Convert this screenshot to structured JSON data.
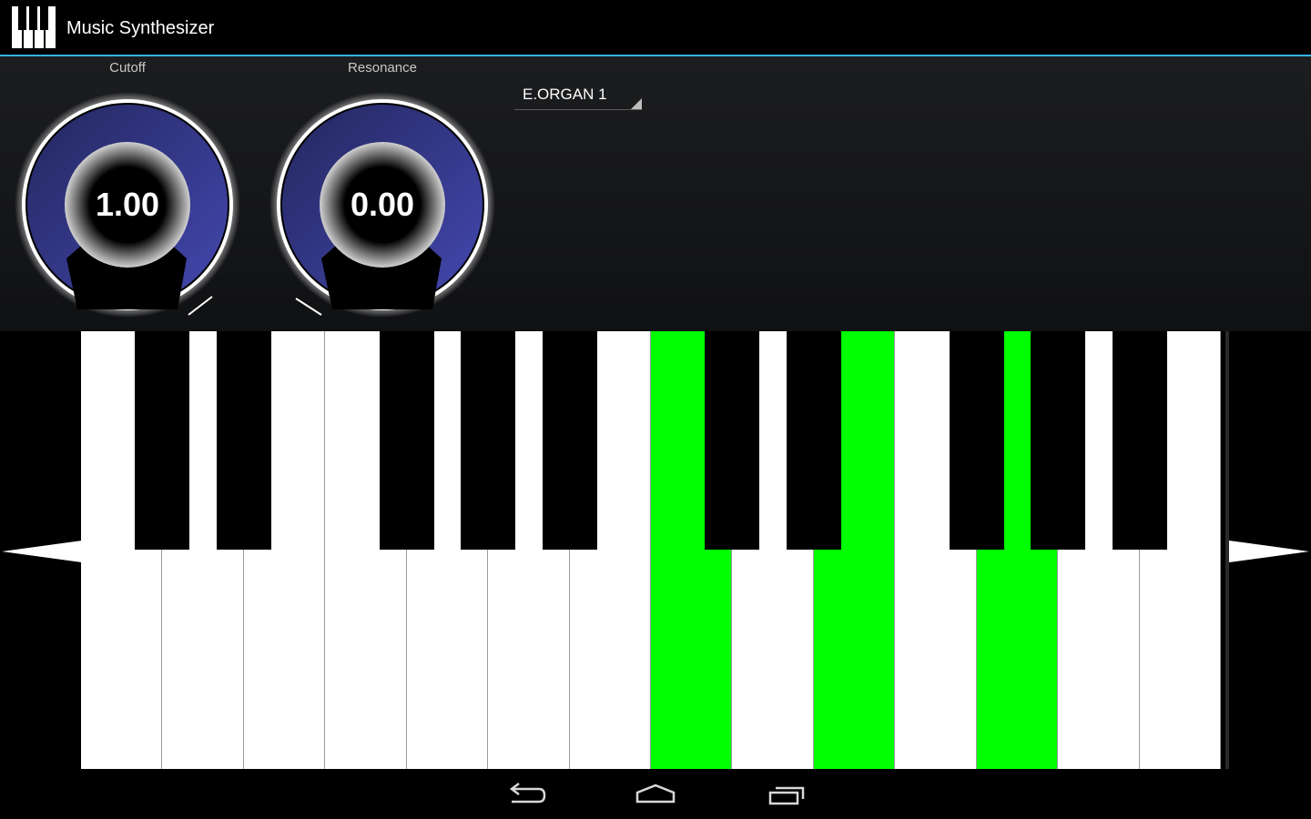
{
  "app": {
    "title": "Music Synthesizer"
  },
  "knobs": [
    {
      "label": "Cutoff",
      "value": "1.00",
      "level": 1.0
    },
    {
      "label": "Resonance",
      "value": "0.00",
      "level": 0.0
    }
  ],
  "instrument": {
    "selected": "E.ORGAN 1"
  },
  "keyboard": {
    "white_keys": 14,
    "pressed_white_keys": [
      7,
      9,
      11
    ],
    "black_key_after_white": [
      0,
      1,
      3,
      4,
      5,
      7,
      8,
      10,
      11,
      12
    ],
    "pressed_black_keys": [],
    "partial_highlight": {
      "between_white": [
        10,
        11
      ],
      "color": "#00ff00"
    },
    "press_color": "#00ff00"
  },
  "colors": {
    "accent": "#33b5e5",
    "knob_ring": "#3a3d9c"
  },
  "icons": {
    "app": "piano-keys-icon",
    "scroll_left": "triangle-left-icon",
    "scroll_right": "triangle-right-icon",
    "back": "back-icon",
    "home": "home-icon",
    "recents": "recents-icon"
  }
}
